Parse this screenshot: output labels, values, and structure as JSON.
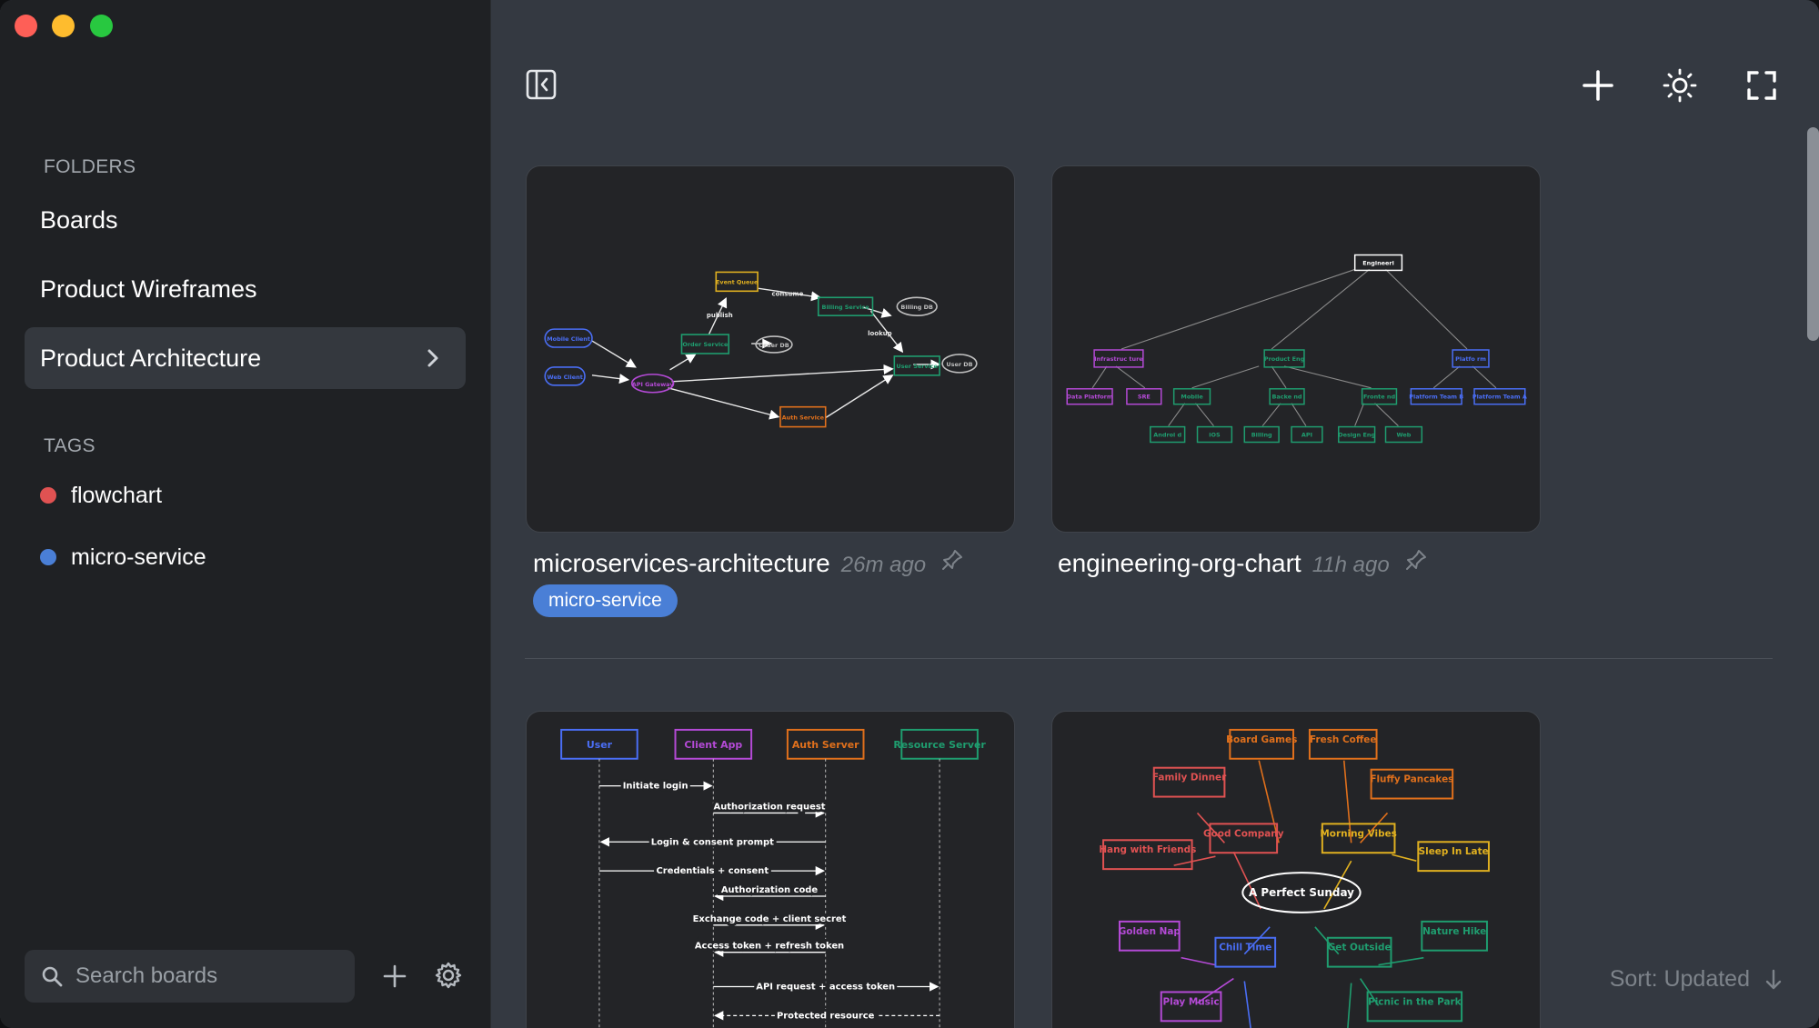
{
  "sidebar": {
    "folders_label": "FOLDERS",
    "folders": [
      {
        "label": "Boards"
      },
      {
        "label": "Product Wireframes"
      },
      {
        "label": "Product Architecture"
      }
    ],
    "tags_label": "TAGS",
    "tags": [
      {
        "label": "flowchart",
        "color": "#e05252"
      },
      {
        "label": "micro-service",
        "color": "#4a7fd6"
      }
    ],
    "search": {
      "placeholder": "Search boards",
      "value": ""
    }
  },
  "toolbar": {
    "icons": [
      "sidebar-toggle-icon",
      "plus-icon",
      "sun-icon",
      "fullscreen-icon"
    ]
  },
  "boards": [
    {
      "title": "microservices-architecture",
      "time": "26m ago",
      "tag": "micro-service",
      "diagram": {
        "nodes": [
          "Mobile Client",
          "Web Client",
          "API Gateway",
          "Order Service",
          "Order DB",
          "Event Queue",
          "Billing Service",
          "Billing DB",
          "Auth Service",
          "User Service",
          "User DB"
        ],
        "edge_labels": [
          "publish",
          "consume",
          "lookup"
        ]
      }
    },
    {
      "title": "engineering-org-chart",
      "time": "11h ago",
      "diagram": {
        "nodes": [
          "Engineeri",
          "Infrastruc ture",
          "Product Eng",
          "Platfo rm",
          "Data Platform",
          "SRE",
          "Mobile",
          "Backe nd",
          "Fronte nd",
          "Platform Team B",
          "Platform Team A",
          "Androi d",
          "iOS",
          "Billing",
          "API",
          "Design Eng",
          "Web"
        ]
      }
    },
    {
      "title": "",
      "time": "",
      "diagram": {
        "participants": [
          "User",
          "Client App",
          "Auth Server",
          "Resource Server"
        ],
        "messages": [
          "Initiate login",
          "Authorization request",
          "Login & consent prompt",
          "Credentials + consent",
          "Authorization code",
          "Exchange code + client secret",
          "Access token + refresh token",
          "API request + access token",
          "Protected resource"
        ]
      }
    },
    {
      "title": "",
      "time": "",
      "diagram": {
        "center": "A Perfect Sunday",
        "nodes": [
          "Board Games",
          "Fresh Coffee",
          "Family Dinner",
          "Fluffy Pancakes",
          "Good Company",
          "Morning Vibes",
          "Hang with Friends",
          "Sleep In Late",
          "Golden Nap",
          "Chill Time",
          "Get Outside",
          "Nature Hike",
          "Play Music",
          "Picnic in the Park"
        ]
      }
    }
  ],
  "sort": {
    "label": "Sort: Updated"
  }
}
